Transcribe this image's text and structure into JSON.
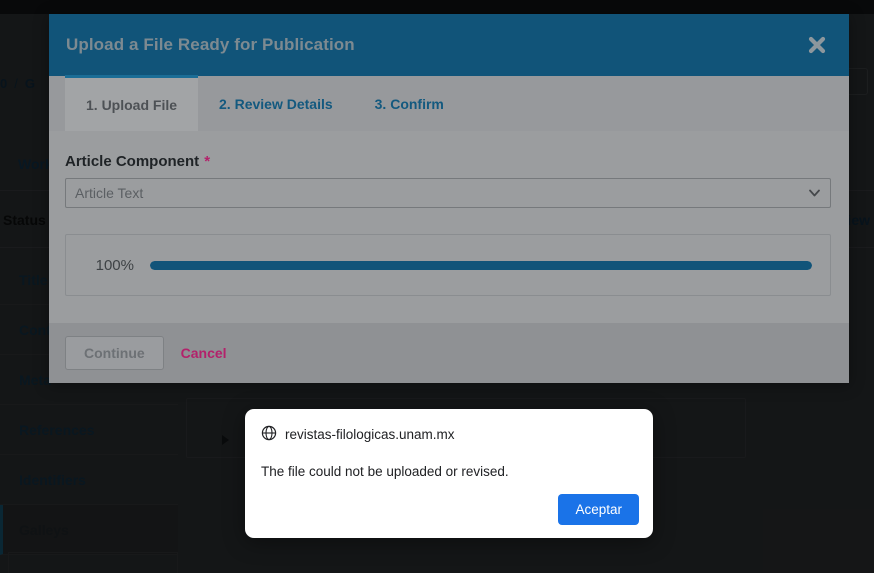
{
  "background": {
    "breadcrumb": {
      "id": "0",
      "separator": "/",
      "current": "G"
    },
    "top_right_button": "P",
    "workflow_link": "Work",
    "status_label": "Status",
    "review_label": "view",
    "nav_items": [
      {
        "label": "Title",
        "active": false
      },
      {
        "label": "Cont",
        "active": false
      },
      {
        "label": "Meta",
        "active": false
      },
      {
        "label": "References",
        "active": false
      },
      {
        "label": "Identifiers",
        "active": false
      },
      {
        "label": "Galleys",
        "active": true
      }
    ],
    "expand_arrow_icon": "triangle-right-icon"
  },
  "modal": {
    "title": "Upload a File Ready for Publication",
    "close_icon": "close-icon",
    "tabs": [
      {
        "label": "1. Upload File",
        "active": true
      },
      {
        "label": "2. Review Details",
        "active": false
      },
      {
        "label": "3. Confirm",
        "active": false
      }
    ],
    "form": {
      "component_label": "Article Component",
      "required_marker": "*",
      "component_value": "Article Text",
      "component_options": [
        "Article Text"
      ],
      "chevron_icon": "chevron-down-icon"
    },
    "upload": {
      "progress_label": "100%",
      "progress_percent": 100
    },
    "footer": {
      "continue_label": "Continue",
      "cancel_label": "Cancel"
    },
    "colors": {
      "header_bg": "#115479",
      "accent": "#1b6d96",
      "required": "#b3226b",
      "cancel": "#b3226b"
    }
  },
  "browser_dialog": {
    "globe_icon": "globe-icon",
    "origin": "revistas-filologicas.unam.mx",
    "message": "The file could not be uploaded or revised.",
    "accept_label": "Aceptar",
    "accept_color": "#1a73e8"
  }
}
